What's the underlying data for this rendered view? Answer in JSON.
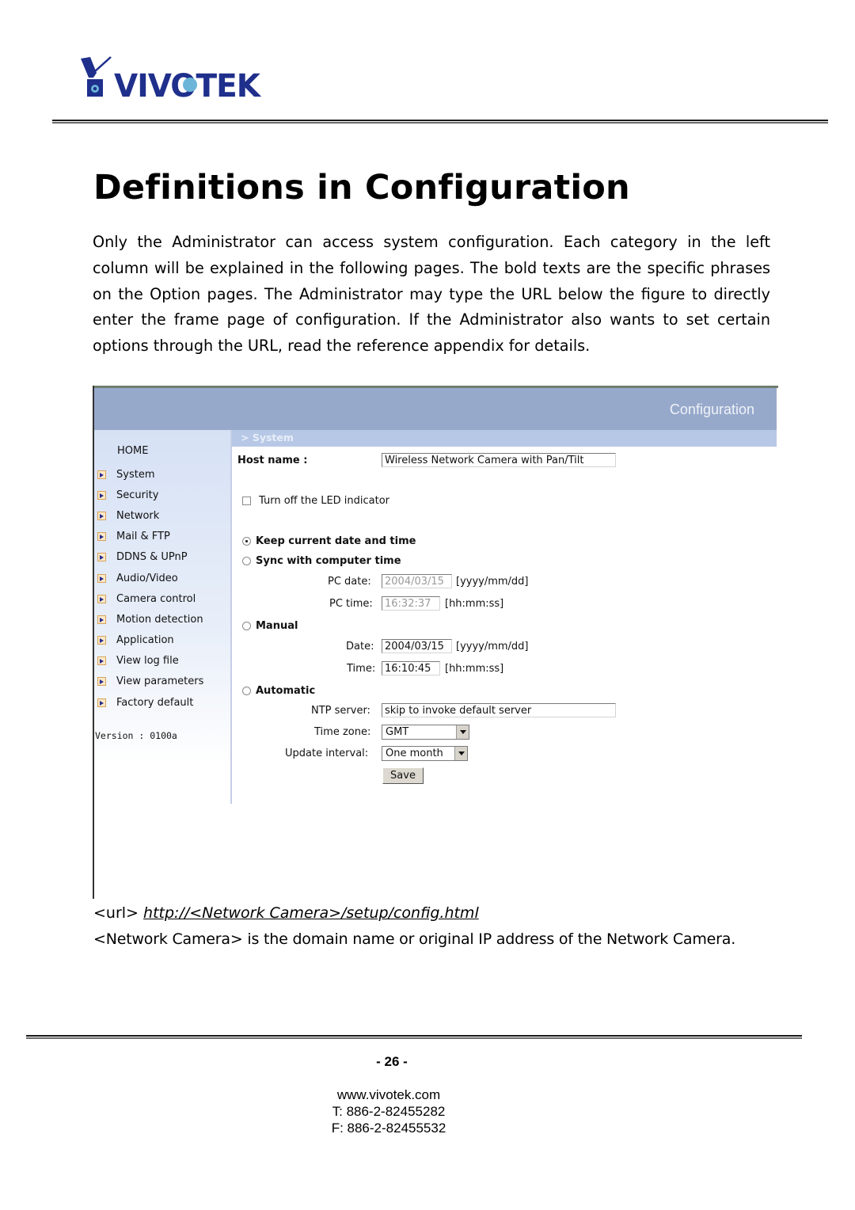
{
  "header": {
    "logo_text": "VIVOTEK",
    "brand_color": "#1f2f8c"
  },
  "page": {
    "title": "Definitions in Configuration",
    "intro": "Only the Administrator can access system configuration. Each category in the left column will be explained in the following pages. The bold texts are the specific phrases on the Option pages. The Administrator may type the URL below the figure to directly enter the frame page of configuration. If the Administrator also wants to set certain options through the URL, read the reference appendix for details."
  },
  "figure": {
    "header_title": "Configuration",
    "breadcrumb": "> System",
    "sidebar": {
      "home": "HOME",
      "items": [
        {
          "label": "System",
          "icon": "arrow-right-icon"
        },
        {
          "label": "Security",
          "icon": "arrow-right-icon"
        },
        {
          "label": "Network",
          "icon": "arrow-right-icon"
        },
        {
          "label": "Mail & FTP",
          "icon": "arrow-right-icon"
        },
        {
          "label": "DDNS & UPnP",
          "icon": "arrow-right-icon"
        },
        {
          "label": "Audio/Video",
          "icon": "arrow-right-icon"
        },
        {
          "label": "Camera control",
          "icon": "arrow-right-icon"
        },
        {
          "label": "Motion detection",
          "icon": "arrow-right-icon"
        },
        {
          "label": "Application",
          "icon": "arrow-right-icon"
        },
        {
          "label": "View log file",
          "icon": "arrow-right-icon"
        },
        {
          "label": "View parameters",
          "icon": "arrow-right-icon"
        },
        {
          "label": "Factory default",
          "icon": "arrow-right-icon"
        }
      ],
      "version": "Version : 0100a"
    },
    "form": {
      "host_name_label": "Host name :",
      "host_name_value": "Wireless Network Camera with Pan/Tilt",
      "led_label": "Turn off the LED indicator",
      "led_checked": false,
      "keep_time_label": "Keep current date and time",
      "sync_label": "Sync with computer time",
      "pc_date_label": "PC date:",
      "pc_date_value": "2004/03/15",
      "date_format": "[yyyy/mm/dd]",
      "pc_time_label": "PC time:",
      "pc_time_value": "16:32:37",
      "time_format": "[hh:mm:ss]",
      "manual_label": "Manual",
      "date_label": "Date:",
      "date_value": "2004/03/15",
      "time_label": "Time:",
      "time_value": "16:10:45",
      "automatic_label": "Automatic",
      "ntp_label": "NTP server:",
      "ntp_value": "skip to invoke default server",
      "timezone_label": "Time zone:",
      "timezone_value": "GMT",
      "interval_label": "Update interval:",
      "interval_value": "One month",
      "save_label": "Save",
      "selected_time_mode": "Keep current date and time"
    }
  },
  "url_line": {
    "prefix": "<url>",
    "link": "http://<Network Camera>/setup/config.html"
  },
  "description": "<Network Camera> is the domain name or original IP address of the Network Camera.",
  "footer": {
    "page_number": "- 26 -",
    "website": "www.vivotek.com",
    "phone": "T: 886-2-82455282",
    "fax": "F: 886-2-82455532"
  }
}
